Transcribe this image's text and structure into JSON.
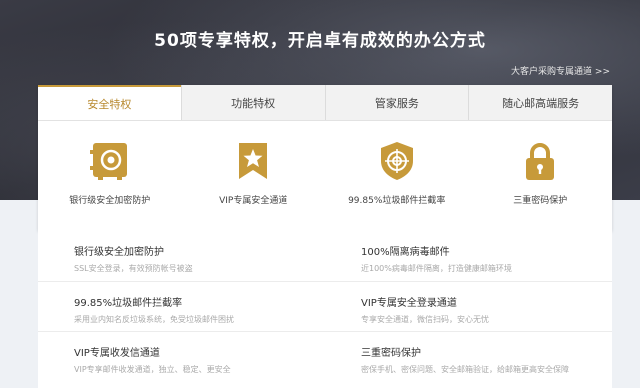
{
  "hero": {
    "title": "50项专享特权，开启卓有成效的办公方式",
    "link": "大客户采购专属通道 >>"
  },
  "tabs": [
    {
      "label": "安全特权",
      "active": true
    },
    {
      "label": "功能特权",
      "active": false
    },
    {
      "label": "管家服务",
      "active": false
    },
    {
      "label": "随心邮高端服务",
      "active": false
    }
  ],
  "features": [
    {
      "label": "银行级安全加密防护",
      "icon": "safe-icon"
    },
    {
      "label": "VIP专属安全通道",
      "icon": "bookmark-star-icon"
    },
    {
      "label": "99.85%垃圾邮件拦截率",
      "icon": "shield-target-icon"
    },
    {
      "label": "三重密码保护",
      "icon": "lock-icon"
    }
  ],
  "list": [
    {
      "title": "银行级安全加密防护",
      "desc": "SSL安全登录，有效预防帐号被盗"
    },
    {
      "title": "100%隔离病毒邮件",
      "desc": "近100%病毒邮件隔离，打造健康邮箱环境"
    },
    {
      "title": "99.85%垃圾邮件拦截率",
      "desc": "采用业内知名反垃圾系统，免受垃圾邮件困扰"
    },
    {
      "title": "VIP专属安全登录通道",
      "desc": "专享安全通道，微信扫码，安心无忧"
    },
    {
      "title": "VIP专属收发信通道",
      "desc": "VIP专享邮件收发通道，独立、稳定、更安全"
    },
    {
      "title": "三重密码保护",
      "desc": "密保手机、密保问题、安全邮箱验证，给邮箱更高安全保障"
    }
  ],
  "colors": {
    "accent": "#c79a3a",
    "accent_dark": "#b8892e"
  }
}
